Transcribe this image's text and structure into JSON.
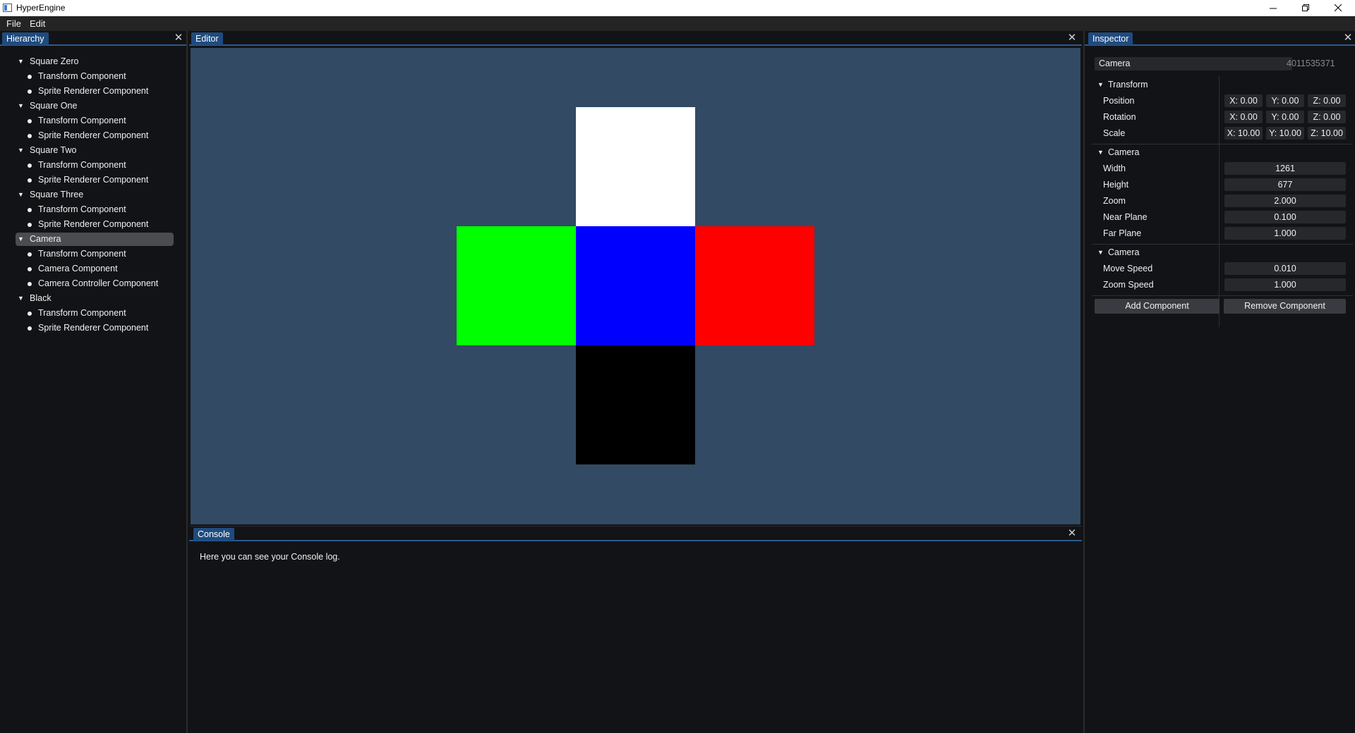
{
  "window": {
    "title": "HyperEngine",
    "controls": [
      "minimize-icon",
      "restore-icon",
      "close-icon"
    ]
  },
  "menu": {
    "items": [
      "File",
      "Edit"
    ]
  },
  "hierarchy": {
    "tab_label": "Hierarchy",
    "entities": [
      {
        "name": "Square Zero",
        "components": [
          "Transform Component",
          "Sprite Renderer Component"
        ]
      },
      {
        "name": "Square One",
        "components": [
          "Transform Component",
          "Sprite Renderer Component"
        ]
      },
      {
        "name": "Square Two",
        "components": [
          "Transform Component",
          "Sprite Renderer Component"
        ]
      },
      {
        "name": "Square Three",
        "components": [
          "Transform Component",
          "Sprite Renderer Component"
        ]
      },
      {
        "name": "Camera",
        "selected": true,
        "components": [
          "Transform Component",
          "Camera Component",
          "Camera Controller Component"
        ]
      },
      {
        "name": "Black",
        "components": [
          "Transform Component",
          "Sprite Renderer Component"
        ]
      }
    ]
  },
  "editor": {
    "tab_label": "Editor",
    "background_color": "#324a63",
    "squares": {
      "top": "#ffffff",
      "left": "#00ff00",
      "center": "#0000ff",
      "right": "#ff0000",
      "bottom": "#000000"
    }
  },
  "console": {
    "tab_label": "Console",
    "log": "Here you can see your Console log."
  },
  "inspector": {
    "tab_label": "Inspector",
    "entity_name": "Camera",
    "entity_id": "4011535371",
    "transform": {
      "header": "Transform",
      "position": {
        "label": "Position",
        "x": "X: 0.00",
        "y": "Y: 0.00",
        "z": "Z: 0.00"
      },
      "rotation": {
        "label": "Rotation",
        "x": "X: 0.00",
        "y": "Y: 0.00",
        "z": "Z: 0.00"
      },
      "scale": {
        "label": "Scale",
        "x": "X: 10.00",
        "y": "Y: 10.00",
        "z": "Z: 10.00"
      }
    },
    "camera": {
      "header": "Camera",
      "width": {
        "label": "Width",
        "value": "1261"
      },
      "height": {
        "label": "Height",
        "value": "677"
      },
      "zoom": {
        "label": "Zoom",
        "value": "2.000"
      },
      "near_plane": {
        "label": "Near Plane",
        "value": "0.100"
      },
      "far_plane": {
        "label": "Far Plane",
        "value": "1.000"
      }
    },
    "camera_controller": {
      "header": "Camera",
      "move_speed": {
        "label": "Move Speed",
        "value": "0.010"
      },
      "zoom_speed": {
        "label": "Zoom Speed",
        "value": "1.000"
      }
    },
    "add_component_label": "Add Component",
    "remove_component_label": "Remove Component"
  }
}
